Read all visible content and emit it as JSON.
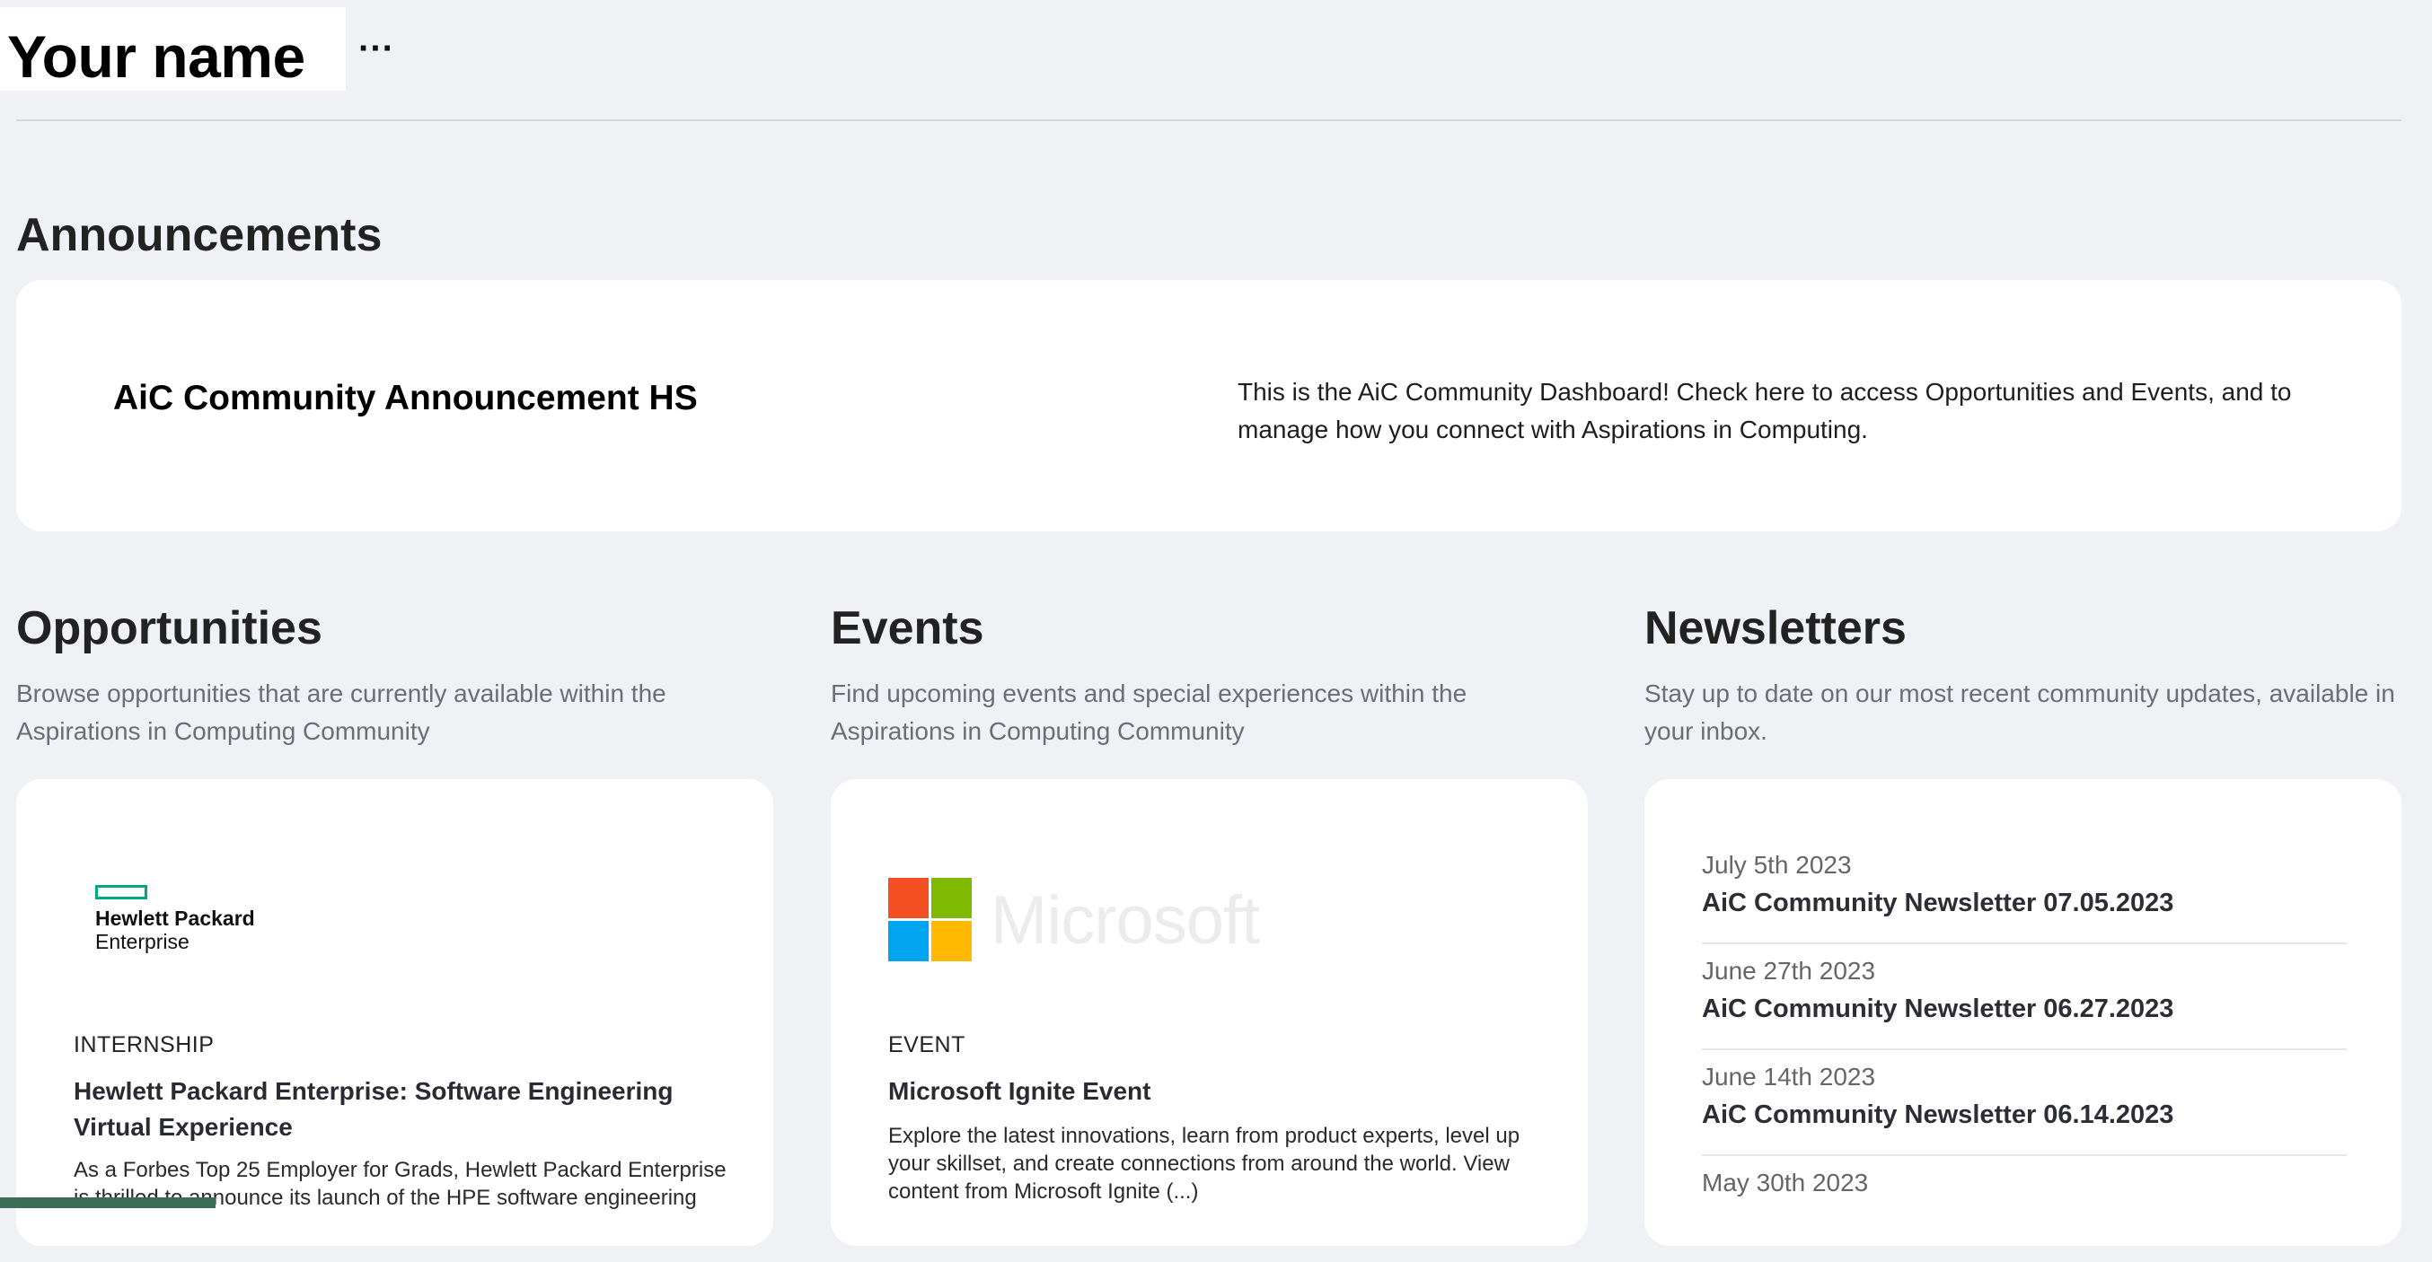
{
  "header": {
    "user_name": "Your name",
    "more_label": "···"
  },
  "announcements": {
    "heading": "Announcements",
    "title": "AiC Community Announcement HS",
    "body": "This is the AiC Community Dashboard! Check here to access Opportunities and Events, and to manage how you connect with Aspirations in Computing."
  },
  "opportunities": {
    "heading": "Opportunities",
    "description": "Browse opportunities that are currently available within the Aspirations in Computing Community",
    "card": {
      "logo_line1": "Hewlett Packard",
      "logo_line2": "Enterprise",
      "kind": "INTERNSHIP",
      "title": "Hewlett Packard Enterprise: Software Engineering Virtual Experience",
      "body": "As a Forbes Top 25 Employer for Grads, Hewlett Packard Enterprise is thrilled to announce its launch of the HPE software engineering"
    }
  },
  "events": {
    "heading": "Events",
    "description": "Find upcoming events and special experiences within the Aspirations in Computing Community",
    "card": {
      "logo_word": "Microsoft",
      "kind": "EVENT",
      "title": "Microsoft Ignite Event",
      "body": "Explore the latest innovations, learn from product experts, level up your skillset, and create connections from around the world. View content from Microsoft Ignite (...)"
    }
  },
  "newsletters": {
    "heading": "Newsletters",
    "description": "Stay up to date on our most recent community updates, available in your inbox.",
    "items": [
      {
        "date": "July 5th 2023",
        "title": "AiC Community Newsletter 07.05.2023"
      },
      {
        "date": "June 27th 2023",
        "title": "AiC Community Newsletter 06.27.2023"
      },
      {
        "date": "June 14th 2023",
        "title": "AiC Community Newsletter 06.14.2023"
      },
      {
        "date": "May 30th 2023",
        "title": ""
      }
    ]
  },
  "colors": {
    "page_bg": "#f0f1f5",
    "card_bg": "#ffffff",
    "hpe_green": "#01a982",
    "ms_red": "#f25022",
    "ms_green": "#7fba00",
    "ms_blue": "#00a4ef",
    "ms_yellow": "#ffb900",
    "bottom_tab": "#3c6e57"
  }
}
